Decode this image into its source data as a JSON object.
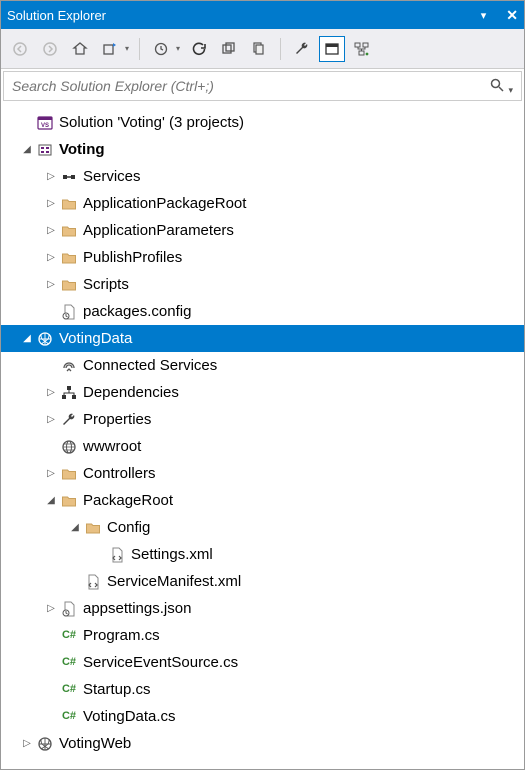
{
  "titlebar": {
    "title": "Solution Explorer"
  },
  "search": {
    "placeholder": "Search Solution Explorer (Ctrl+;)"
  },
  "tree": [
    {
      "depth": 0,
      "exp": "none",
      "icon": "solution",
      "label": "Solution 'Voting' (3 projects)"
    },
    {
      "depth": 0,
      "exp": "open",
      "icon": "sfproj",
      "label": "Voting",
      "bold": true
    },
    {
      "depth": 1,
      "exp": "closed",
      "icon": "services",
      "label": "Services"
    },
    {
      "depth": 1,
      "exp": "closed",
      "icon": "folder",
      "label": "ApplicationPackageRoot"
    },
    {
      "depth": 1,
      "exp": "closed",
      "icon": "folder",
      "label": "ApplicationParameters"
    },
    {
      "depth": 1,
      "exp": "closed",
      "icon": "folder",
      "label": "PublishProfiles"
    },
    {
      "depth": 1,
      "exp": "closed",
      "icon": "folder",
      "label": "Scripts"
    },
    {
      "depth": 1,
      "exp": "none",
      "icon": "config",
      "label": "packages.config"
    },
    {
      "depth": 0,
      "exp": "open",
      "icon": "webproj",
      "label": "VotingData",
      "selected": true
    },
    {
      "depth": 1,
      "exp": "none",
      "icon": "connected",
      "label": "Connected Services"
    },
    {
      "depth": 1,
      "exp": "closed",
      "icon": "deps",
      "label": "Dependencies"
    },
    {
      "depth": 1,
      "exp": "closed",
      "icon": "wrench",
      "label": "Properties"
    },
    {
      "depth": 1,
      "exp": "none",
      "icon": "globe",
      "label": "wwwroot"
    },
    {
      "depth": 1,
      "exp": "closed",
      "icon": "folder",
      "label": "Controllers"
    },
    {
      "depth": 1,
      "exp": "open",
      "icon": "folder",
      "label": "PackageRoot"
    },
    {
      "depth": 2,
      "exp": "open",
      "icon": "folder",
      "label": "Config"
    },
    {
      "depth": 3,
      "exp": "none",
      "icon": "xml",
      "label": "Settings.xml"
    },
    {
      "depth": 2,
      "exp": "none",
      "icon": "xml",
      "label": "ServiceManifest.xml"
    },
    {
      "depth": 1,
      "exp": "closed",
      "icon": "json",
      "label": "appsettings.json"
    },
    {
      "depth": 1,
      "exp": "none",
      "icon": "cs",
      "label": "Program.cs"
    },
    {
      "depth": 1,
      "exp": "none",
      "icon": "cs",
      "label": "ServiceEventSource.cs"
    },
    {
      "depth": 1,
      "exp": "none",
      "icon": "cs",
      "label": "Startup.cs"
    },
    {
      "depth": 1,
      "exp": "none",
      "icon": "cs",
      "label": "VotingData.cs"
    },
    {
      "depth": 0,
      "exp": "closed",
      "icon": "webproj",
      "label": "VotingWeb"
    }
  ]
}
